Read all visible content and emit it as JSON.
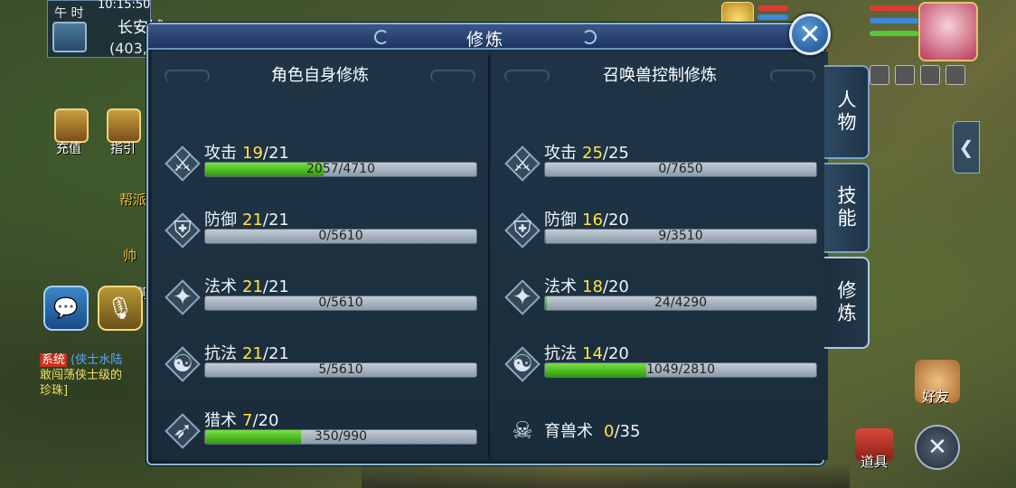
{
  "hud": {
    "time_label": "午 时",
    "clock": "10:15:50",
    "location": "长安城",
    "coords": "(403,",
    "side_buttons": [
      {
        "label": "充值",
        "icon": "treasure-chest-icon"
      },
      {
        "label": "指引",
        "icon": "question-scroll-icon"
      }
    ],
    "bg_text_1": "帮派",
    "bg_text_2": "帅",
    "bg_text_3": "帮",
    "chat": {
      "sys_tag": "系统",
      "line1": "(侠士水陆",
      "line2": "敢闯荡侠士级的",
      "line3": "珍珠]"
    },
    "friends_label": "好友",
    "items_label": "道具"
  },
  "panel": {
    "title": "修炼",
    "close_icon": "✕",
    "left": {
      "title": "角色自身修炼",
      "rows": [
        {
          "name": "攻击",
          "level": "19",
          "max": "/21",
          "progress": "2057/4710",
          "fill": 0.437,
          "icon": "sword-icon",
          "glyph": "⚔"
        },
        {
          "name": "防御",
          "level": "21",
          "max": "/21",
          "progress": "0/5610",
          "fill": 0,
          "icon": "shield-icon",
          "glyph": "⛨"
        },
        {
          "name": "法术",
          "level": "21",
          "max": "/21",
          "progress": "0/5610",
          "fill": 0,
          "icon": "staff-icon",
          "glyph": "✦"
        },
        {
          "name": "抗法",
          "level": "21",
          "max": "/21",
          "progress": "5/5610",
          "fill": 0.001,
          "icon": "yin-yang-icon",
          "glyph": "☯"
        },
        {
          "name": "猎术",
          "level": "7",
          "max": "/20",
          "progress": "350/990",
          "fill": 0.354,
          "icon": "bow-icon",
          "glyph": "➶"
        }
      ]
    },
    "right": {
      "title": "召唤兽控制修炼",
      "rows": [
        {
          "name": "攻击",
          "level": "25",
          "max": "/25",
          "progress": "0/7650",
          "fill": 0,
          "icon": "sword-icon",
          "glyph": "⚔"
        },
        {
          "name": "防御",
          "level": "16",
          "max": "/20",
          "progress": "9/3510",
          "fill": 0.003,
          "icon": "shield-icon",
          "glyph": "⛨"
        },
        {
          "name": "法术",
          "level": "18",
          "max": "/20",
          "progress": "24/4290",
          "fill": 0.006,
          "icon": "staff-icon",
          "glyph": "✦"
        },
        {
          "name": "抗法",
          "level": "14",
          "max": "/20",
          "progress": "1049/2810",
          "fill": 0.373,
          "icon": "yin-yang-icon",
          "glyph": "☯"
        }
      ],
      "beast_row": {
        "name": "育兽术",
        "level": "0",
        "max": "/35",
        "icon": "pet-skull-icon",
        "glyph": "☠"
      }
    }
  },
  "tabs": [
    {
      "label": "人物",
      "active": false
    },
    {
      "label": "技能",
      "active": false
    },
    {
      "label": "修炼",
      "active": true
    }
  ],
  "colors": {
    "level_highlight": "#ffe640",
    "progress_fill": "#52c028",
    "panel_bg": "#1c2e3e",
    "header_bg": "#2a4676"
  }
}
